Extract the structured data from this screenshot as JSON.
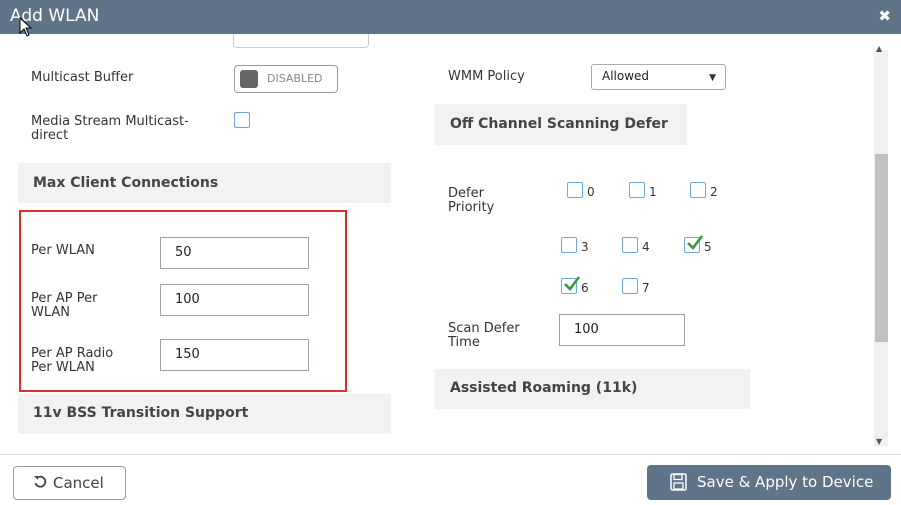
{
  "dialog": {
    "title": "Add WLAN"
  },
  "left": {
    "multicast_buffer": {
      "label": "Multicast Buffer",
      "toggle_text": "DISABLED"
    },
    "media_stream": {
      "label_line1": "Media Stream Multicast-",
      "label_line2": "direct"
    },
    "max_client_connections": {
      "section_title": "Max Client Connections",
      "per_wlan_label": "Per WLAN",
      "per_wlan_value": "50",
      "per_ap_per_wlan_label_line1": "Per AP Per",
      "per_ap_per_wlan_label_line2": "WLAN",
      "per_ap_per_wlan_value": "100",
      "per_ap_radio_label_line1": "Per AP Radio",
      "per_ap_radio_label_line2": "Per WLAN",
      "per_ap_radio_value": "150"
    },
    "bss_transition": {
      "section_title": "11v BSS Transition Support"
    }
  },
  "right": {
    "wmm_policy": {
      "label": "WMM Policy",
      "selected": "Allowed"
    },
    "off_channel": {
      "section_title": "Off Channel Scanning Defer",
      "defer_priority_line1": "Defer",
      "defer_priority_line2": "Priority",
      "priorities": [
        {
          "num": "0",
          "checked": false
        },
        {
          "num": "1",
          "checked": false
        },
        {
          "num": "2",
          "checked": false
        },
        {
          "num": "3",
          "checked": false
        },
        {
          "num": "4",
          "checked": false
        },
        {
          "num": "5",
          "checked": true
        },
        {
          "num": "6",
          "checked": true
        },
        {
          "num": "7",
          "checked": false
        }
      ],
      "scan_defer_time_line1": "Scan Defer",
      "scan_defer_time_line2": "Time",
      "scan_defer_time_value": "100"
    },
    "assisted_roaming": {
      "section_title": "Assisted Roaming (11k)"
    }
  },
  "footer": {
    "cancel_label": "Cancel",
    "save_label": "Save & Apply to Device"
  },
  "colors": {
    "header_bg": "#5f7489",
    "highlight_border": "#d9312b",
    "checkbox_border": "#6fa8d6",
    "check_green": "#3a9a35"
  }
}
